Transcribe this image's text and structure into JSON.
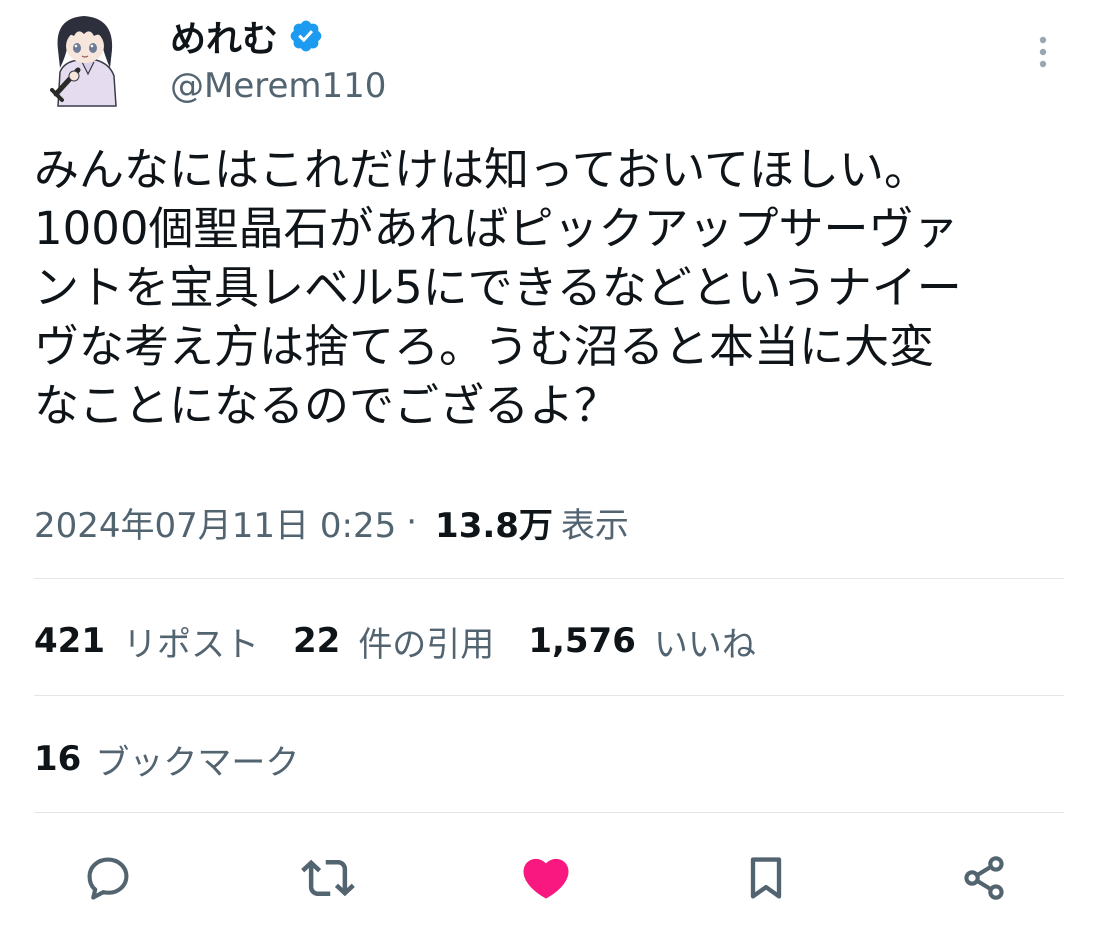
{
  "author": {
    "display_name": "めれむ",
    "handle": "@Merem110",
    "verified": true
  },
  "tweet": {
    "text": "みんなにはこれだけは知っておいてほしい。\n1000個聖晶石があればピックアップサーヴァ\nントを宝具レベル5にできるなどというナイー\nヴな考え方は捨てろ。うむ沼ると本当に大変\nなことになるのでござるよ？",
    "timestamp": "2024年07月11日 0:25",
    "separator": "·",
    "views_count": "13.8万",
    "views_label": "表示"
  },
  "stats": {
    "reposts": {
      "count": "421",
      "label": "リポスト"
    },
    "quotes": {
      "count": "22",
      "label": "件の引用"
    },
    "likes": {
      "count": "1,576",
      "label": "いいね"
    },
    "bookmarks": {
      "count": "16",
      "label": "ブックマーク"
    }
  },
  "icons": {
    "verified": "verified-badge-icon",
    "more": "more-vertical-icon",
    "reply": "reply-icon",
    "repost": "repost-icon",
    "like": "heart-icon",
    "bookmark": "bookmark-icon",
    "share": "share-icon"
  },
  "colors": {
    "verified_blue": "#1d9bf0",
    "like_pink": "#f91880",
    "secondary_text": "#536471",
    "primary_text": "#0f1419",
    "divider": "#e2e6e9"
  }
}
